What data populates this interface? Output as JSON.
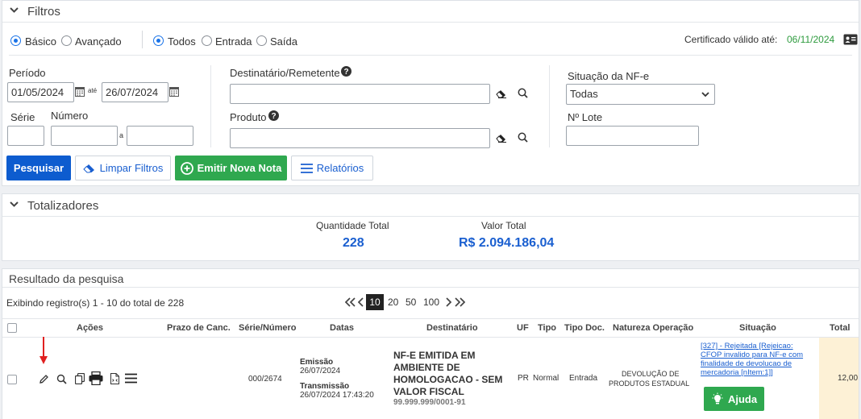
{
  "filtros": {
    "title": "Filtros",
    "mode_basic": "Básico",
    "mode_advanced": "Avançado",
    "dir_all": "Todos",
    "dir_in": "Entrada",
    "dir_out": "Saída",
    "cert_label": "Certificado válido até:",
    "cert_date": "06/11/2024",
    "periodo_label": "Período",
    "periodo_from": "01/05/2024",
    "periodo_ate": "até",
    "periodo_to": "26/07/2024",
    "serie_label": "Série",
    "numero_label": "Número",
    "numero_sep": "a",
    "dest_label": "Destinatário/Remetente",
    "produto_label": "Produto",
    "situacao_label": "Situação da NF-e",
    "situacao_value": "Todas",
    "lote_label": "Nº Lote",
    "btn_search": "Pesquisar",
    "btn_clear": "Limpar Filtros",
    "btn_new": "Emitir Nova Nota",
    "btn_reports": "Relatórios"
  },
  "totalizadores": {
    "title": "Totalizadores",
    "qty_label": "Quantidade Total",
    "qty_value": "228",
    "value_label": "Valor Total",
    "value_value": "R$ 2.094.186,04"
  },
  "resultado": {
    "title": "Resultado da pesquisa",
    "showing": "Exibindo registro(s) 1 - 10 do total de 228",
    "page_sizes": [
      "10",
      "20",
      "50",
      "100"
    ],
    "page_size_selected": "10",
    "columns": [
      "Ações",
      "Prazo de Canc.",
      "Série/Número",
      "Datas",
      "Destinatário",
      "UF",
      "Tipo",
      "Tipo Doc.",
      "Natureza Operação",
      "Situação",
      "Total"
    ],
    "row": {
      "serie_numero": "000/2674",
      "emissao_label": "Emissão",
      "emissao_date": "26/07/2024",
      "transmissao_label": "Transmissão",
      "transmissao_date": "26/07/2024 17:43:20",
      "dest_name_1": "NF-E EMITIDA EM",
      "dest_name_2": "AMBIENTE DE",
      "dest_name_3": "HOMOLOGACAO - SEM",
      "dest_name_4": "VALOR FISCAL",
      "dest_doc": "99.999.999/0001-91",
      "uf": "PR",
      "tipo": "Normal",
      "tipo_doc": "Entrada",
      "natureza_1": "DEVOLUÇÃO DE",
      "natureza_2": "PRODUTOS ESTADUAL",
      "situacao_1": "[327] - Rejeitada [Rejeicao:",
      "situacao_2": "CFOP invalido para NF-e com",
      "situacao_3": "finalidade de devolucao de",
      "situacao_4": "mercadoria [nItem:1]]",
      "ajuda": "Ajuda",
      "total": "12,00"
    }
  },
  "colors": {
    "primary": "#0d5ccf",
    "success": "#2fa84f",
    "link": "#1a5fd0",
    "cert_date": "#2e9b3e",
    "total_bg": "#fdf1d6",
    "annotation_arrow": "#e02020"
  }
}
